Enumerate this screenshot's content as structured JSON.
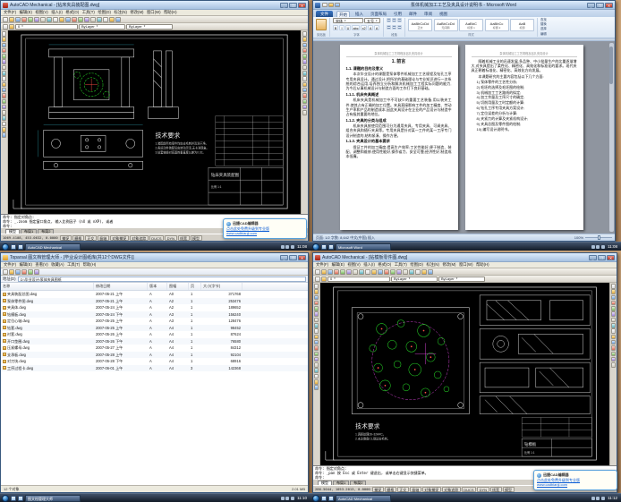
{
  "balloon": {
    "title": "迅捷CAD编辑器",
    "line1": "点击此处免费升级到专业版",
    "line2": "www.cadbianji.com"
  },
  "cad1": {
    "title": "AutoCAD Mechanical - [钻床夹具装配图.dwg]",
    "task_label": "AutoCAD Mechanical",
    "taskbar_time": "11:08",
    "menu": [
      "文件(F)",
      "编辑(E)",
      "视图(V)",
      "插入(I)",
      "格式(O)",
      "工具(T)",
      "绘图(D)",
      "标注(N)",
      "修改(M)",
      "窗口(W)",
      "帮助(H)"
    ],
    "toolbar1": [
      "new-icon",
      "open-icon",
      "save-icon",
      "plot-icon",
      "preview-icon",
      "publish-icon",
      "cut-icon",
      "copy-icon",
      "paste-icon",
      "matchprop-icon",
      "undo-icon",
      "redo-icon",
      "pan-icon",
      "zoom-realtime-icon",
      "zoom-window-icon",
      "zoom-previous-icon",
      "properties-icon",
      "designcenter-icon",
      "toolpalettes-icon"
    ],
    "toolbar2_icons": [
      "layer-properties-icon",
      "layer-states-icon"
    ],
    "layer_name": "0",
    "color_name": "ByLayer",
    "linetype_name": "ByLayer",
    "left_tools": [
      "line-icon",
      "xline-icon",
      "mline-icon",
      "polyline-icon",
      "polygon-icon",
      "rectangle-icon",
      "arc-icon",
      "circle-icon",
      "revcloud-icon",
      "spline-icon",
      "ellipse-icon",
      "insert-block-icon",
      "make-block-icon",
      "point-icon",
      "hatch-icon",
      "gradient-icon",
      "region-icon",
      "table-icon",
      "mtext-icon"
    ],
    "right_tools": [
      "erase-icon",
      "copy-object-icon",
      "mirror-icon",
      "offset-icon",
      "array-icon",
      "move-icon",
      "rotate-icon",
      "scale-icon",
      "stretch-icon",
      "trim-icon",
      "extend-icon",
      "break-icon",
      "chamfer-icon",
      "fillet-icon",
      "explode-icon"
    ],
    "drawing": {
      "tech_title": "技术要求",
      "req1": "1.装配前所有零件均应去毛刺并清洗干净。",
      "req2": "2.各运动件装配后应转动灵活,无卡滞现象。",
      "req3": "3.钻套轴线对底面的垂直度公差为0.02。",
      "block_name": "钻床夹具装配图",
      "block_scale": "比例 1:1"
    },
    "command_lines": [
      "命令: 指定对角点:",
      "命令: _.zoom 指定窗口角点, 输入比例因子 (nX 或 nXP), 或者",
      "命令:"
    ],
    "model_tabs": [
      "模型",
      "布局1",
      "布局2"
    ],
    "status": {
      "coords": "1069.4108, 453.0632, 0.0000",
      "buttons": [
        "捕捉",
        "栅格",
        "正交",
        "极轴",
        "对象捕捉",
        "对象追踪",
        "DUCS",
        "DYN",
        "线宽",
        "模型"
      ]
    }
  },
  "word": {
    "title": "泵体机械加工工艺及夹具设计说明书 - Microsoft Word",
    "task_label": "Microsoft Word",
    "taskbar_time": "11:08",
    "qat": [
      "save-icon",
      "undo-icon",
      "redo-icon"
    ],
    "file_tab": "文件",
    "tabs": [
      "开始",
      "插入",
      "页面布局",
      "引用",
      "邮件",
      "审阅",
      "视图"
    ],
    "font_name": "宋体",
    "font_size": "五号",
    "format_buttons": [
      "B",
      "I",
      "U",
      "abc",
      "x2",
      "A",
      "A"
    ],
    "styles": [
      {
        "sample": "AaBbCcDd",
        "name": "正文"
      },
      {
        "sample": "AaBbCcDd",
        "name": "无间隔"
      },
      {
        "sample": "AaBbC",
        "name": "标题 1"
      },
      {
        "sample": "AaBbCc",
        "name": "标题 2"
      },
      {
        "sample": "AaB",
        "name": "标题"
      }
    ],
    "editing": [
      "查找",
      "替换",
      "选择"
    ],
    "group_labels": {
      "clipboard": "剪贴板",
      "font": "字体",
      "paragraph": "段落",
      "styles": "样式",
      "editing": "编辑"
    },
    "page_header": "泵体机械加工工艺规程及钻孔夹具设计",
    "page1": {
      "chapter": "1. 前言",
      "sections": [
        {
          "h": "1.1. 课题的目的及意义",
          "b": "本次毕业设计的课题是泵体零件机械加工工艺规程及钻孔工序专用夹具设计。通过设计,把所学的基础理论与专业知识进行一次系统的综合运用,培养独立分析和解决机械加工工程实际问题的能力,为今后从事机械设计与制造方面的工作打下良好基础。"
        },
        {
          "h": "1.1.1. 机床夹具概述",
          "b": "机床夹具是机械加工中不可缺少的重要工艺装备,用以装夹工件,使其占有正确的加工位置。夹具直接影响工件的加工精度、劳动生产率和产品的制造成本,因此夹具设计在企业的产品设计与制造中占有极其重要的地位。"
        },
        {
          "h": "1.1.2. 夹具的分类与组成",
          "b": "机床夹具按使用范围可分为通用夹具、专用夹具、可调夹具、组合夹具和随行夹具等。专用夹具是针对某一工件的某一工序专门设计制造的,结构紧凑、操作方便。"
        },
        {
          "h": "1.1.3. 夹具设计的基本要求",
          "b": "保证工件的加工精度;提高生产效率;工艺性能好,便于制造、装配、调整和维修;使用性能好,操作省力、安全可靠;经济性好,制造成本低廉。"
        }
      ]
    },
    "page2": {
      "paras": [
        "随着机械工业的迅速发展,多品种、中小批量生产的比重逐渐增大,对夹具提出了柔性化、精密化、高效化和标准化的要求。现代夹具正朝着标准化、精密化、高效化方向发展。",
        "本课题研究的主要内容包括以下几个方面:"
      ],
      "items": [
        "1) 泵体零件的工艺性分析;",
        "2) 毛坯的选择及毛坯图的绘制;",
        "3) 机械加工工艺路线的拟定;",
        "4) 加工余量及工序尺寸的确定;",
        "5) 切削用量及工时定额的计算;",
        "6) 钻孔工序专用夹具方案设计;",
        "7) 定位误差的分析与计算;",
        "8) 夹紧力的计算及夹紧机构设计;",
        "9) 夹具总图及零件图的绘制;",
        "10) 编写设计说明书。"
      ]
    },
    "status_left": "页面: 1/2  字数: 8,642  中文(中国)  插入",
    "zoom": "100%"
  },
  "files": {
    "title": "Toparsal 图文档管理大师 - [毕业设计图纸库(共12个DWG文件)]",
    "task_label": "图文档管理大师",
    "taskbar_time": "11:10",
    "menu": [
      "文件(F)",
      "编辑(E)",
      "查看(V)",
      "收藏(A)",
      "工具(T)",
      "帮助(H)"
    ],
    "toolbar": [
      "back-icon",
      "forward-icon",
      "up-icon",
      "search-icon",
      "folders-icon",
      "views-icon"
    ],
    "address_label": "地址(D)",
    "address": "D:\\毕业设计\\泵体夹具图纸",
    "columns": [
      "名称",
      "修改日期",
      "版本",
      "图幅",
      "页",
      "大小(字节)"
    ],
    "rows": [
      {
        "name": "夹具装配总图.dwg",
        "date": "2007-05-21 上午",
        "ver": "A",
        "sheet": "A0",
        "pg": "1",
        "size": "371768"
      },
      {
        "name": "泵体零件图.dwg",
        "date": "2007-05-21 上午",
        "ver": "A",
        "sheet": "A2",
        "pg": "1",
        "size": "253476"
      },
      {
        "name": "夹具体.dwg",
        "date": "2007-05-24 上午",
        "ver": "A",
        "sheet": "A2",
        "pg": "1",
        "size": "189652"
      },
      {
        "name": "钻模板.dwg",
        "date": "2007-05-24 下午",
        "ver": "A",
        "sheet": "A3",
        "pg": "1",
        "size": "156240"
      },
      {
        "name": "定位心轴.dwg",
        "date": "2007-05-25 上午",
        "ver": "A",
        "sheet": "A3",
        "pg": "1",
        "size": "128476"
      },
      {
        "name": "钻套.dwg",
        "date": "2007-05-25 上午",
        "ver": "A",
        "sheet": "A4",
        "pg": "1",
        "size": "98452"
      },
      {
        "name": "衬套.dwg",
        "date": "2007-05-26 上午",
        "ver": "A",
        "sheet": "A4",
        "pg": "1",
        "size": "87624"
      },
      {
        "name": "开口垫圈.dwg",
        "date": "2007-05-26 下午",
        "ver": "A",
        "sheet": "A4",
        "pg": "1",
        "size": "76580"
      },
      {
        "name": "压紧螺母.dwg",
        "date": "2007-05-27 上午",
        "ver": "A",
        "sheet": "A4",
        "pg": "1",
        "size": "84312"
      },
      {
        "name": "支承板.dwg",
        "date": "2007-05-28 上午",
        "ver": "A",
        "sheet": "A4",
        "pg": "1",
        "size": "92104"
      },
      {
        "name": "对刀块.dwg",
        "date": "2007-05-28 下午",
        "ver": "A",
        "sheet": "A4",
        "pg": "1",
        "size": "68916"
      },
      {
        "name": "工序过程卡.dwg",
        "date": "2007-06-01 上午",
        "ver": "A",
        "sheet": "A4",
        "pg": "3",
        "size": "142368"
      }
    ],
    "status_left": "12 个对象",
    "status_right": "2.01 MB"
  },
  "cad2": {
    "title": "AutoCAD Mechanical - [钻模板零件图.dwg]",
    "task_label": "AutoCAD Mechanical",
    "taskbar_time": "11:12",
    "menu": [
      "文件(F)",
      "编辑(E)",
      "视图(V)",
      "插入(I)",
      "格式(O)",
      "工具(T)",
      "绘图(D)",
      "标注(N)",
      "修改(M)",
      "窗口(W)",
      "帮助(H)"
    ],
    "toolbar1": [
      "new-icon",
      "open-icon",
      "save-icon",
      "plot-icon",
      "preview-icon",
      "publish-icon",
      "cut-icon",
      "copy-icon",
      "paste-icon",
      "matchprop-icon",
      "undo-icon",
      "redo-icon",
      "pan-icon",
      "zoom-realtime-icon",
      "zoom-window-icon",
      "zoom-previous-icon",
      "properties-icon",
      "designcenter-icon",
      "toolpalettes-icon"
    ],
    "toolbar2_icons": [
      "layer-properties-icon",
      "layer-states-icon"
    ],
    "layer_name": "0",
    "color_name": "ByLayer",
    "linetype_name": "ByLayer",
    "left_tools": [
      "line-icon",
      "xline-icon",
      "mline-icon",
      "polyline-icon",
      "polygon-icon",
      "rectangle-icon",
      "arc-icon",
      "circle-icon",
      "revcloud-icon",
      "spline-icon",
      "ellipse-icon",
      "insert-block-icon",
      "make-block-icon",
      "point-icon",
      "hatch-icon",
      "gradient-icon",
      "region-icon",
      "table-icon",
      "mtext-icon"
    ],
    "right_tools": [
      "erase-icon",
      "copy-object-icon",
      "mirror-icon",
      "offset-icon",
      "array-icon",
      "move-icon",
      "rotate-icon",
      "scale-icon",
      "stretch-icon",
      "trim-icon",
      "extend-icon",
      "break-icon",
      "chamfer-icon",
      "fillet-icon",
      "explode-icon"
    ],
    "drawing": {
      "tech_title": "技术要求",
      "req1": "1.调质处理28~32HRC。",
      "req2": "2.未注倒角C1,锐边去毛刺。",
      "block_name": "钻模板",
      "block_scale": "比例 1:1"
    },
    "command_lines": [
      "命令: 指定对角点:",
      "命令: _pan 按 Esc 或 Enter 键退出, 或单击右键显示快捷菜单。",
      "命令:"
    ],
    "model_tabs": [
      "模型",
      "布局1",
      "布局2"
    ],
    "status": {
      "coords": "286.5044, 1053.2013, 0.0000",
      "buttons": [
        "捕捉",
        "栅格",
        "正交",
        "极轴",
        "对象捕捉",
        "对象追踪",
        "DUCS",
        "DYN",
        "线宽",
        "模型"
      ]
    }
  }
}
